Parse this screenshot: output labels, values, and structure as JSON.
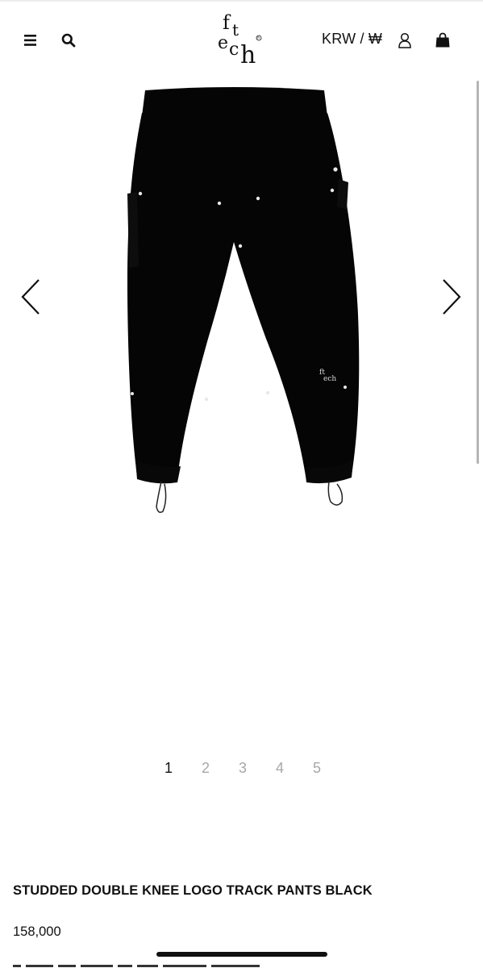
{
  "header": {
    "brand": "fitech",
    "currency_label": "KRW / ₩",
    "icons": [
      "hamburger-menu-icon",
      "search-icon",
      "account-user-icon",
      "shopping-bag-icon"
    ]
  },
  "gallery": {
    "image_alt": "Black track pants with studs",
    "pages": [
      "1",
      "2",
      "3",
      "4",
      "5"
    ],
    "active_page": 1
  },
  "product": {
    "name": "STUDDED DOUBLE KNEE LOGO TRACK PANTS BLACK",
    "price": "158,000"
  },
  "colors": {
    "text": "#111111",
    "inactive_page": "#a8a8a8",
    "product": "#050505"
  }
}
